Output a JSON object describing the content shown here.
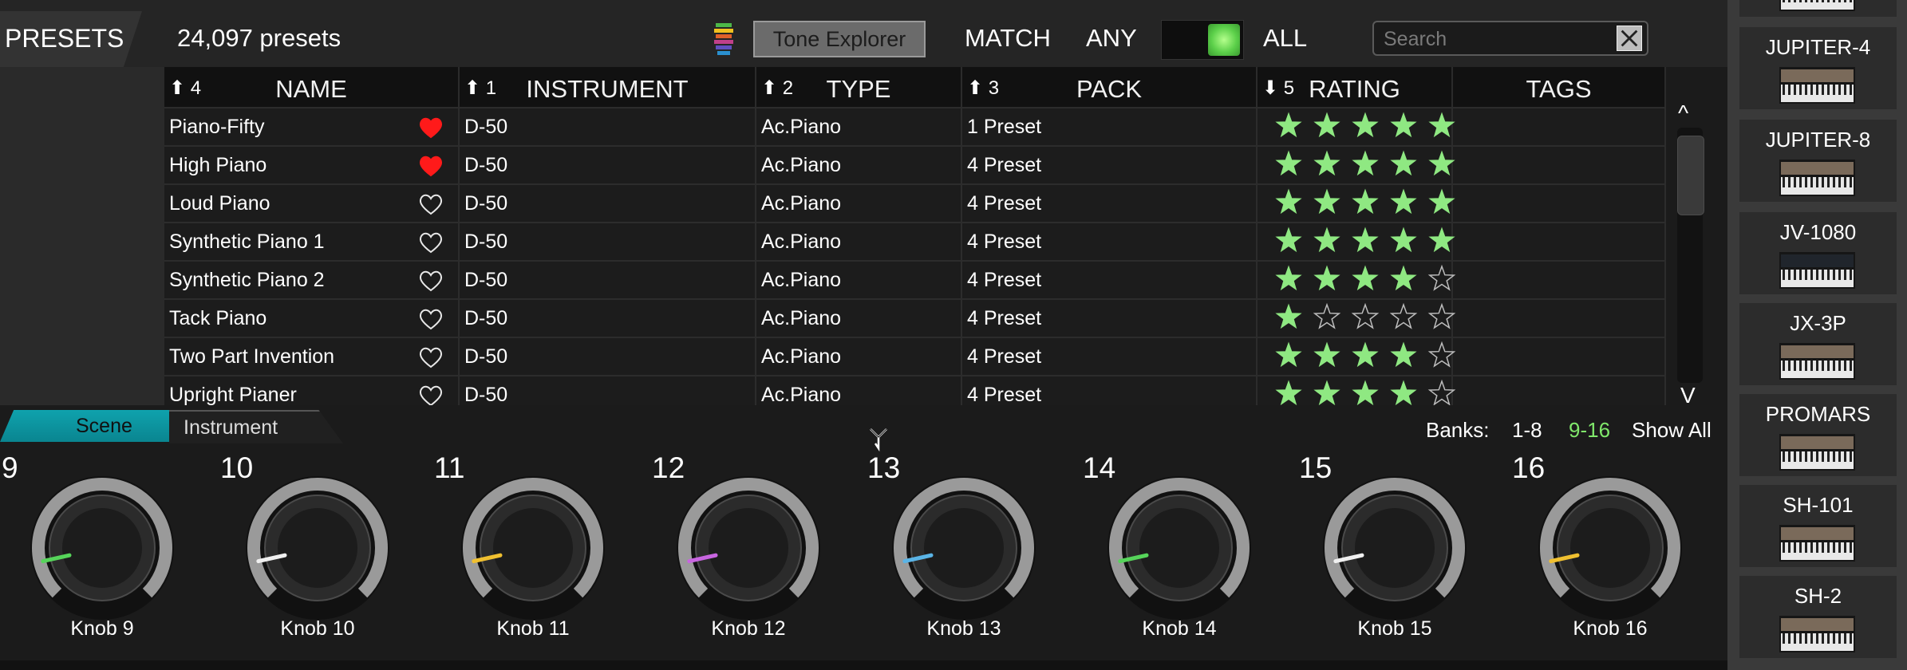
{
  "header": {
    "presets_label": "PRESETS",
    "preset_count": "24,097 presets",
    "tone_explorer_label": "Tone Explorer",
    "match_label": "MATCH",
    "any_label": "ANY",
    "all_label": "ALL",
    "match_all_enabled": true,
    "search_placeholder": "Search"
  },
  "table": {
    "columns": [
      {
        "order": "4",
        "label": "NAME",
        "sort": "asc"
      },
      {
        "order": "1",
        "label": "INSTRUMENT",
        "sort": "asc"
      },
      {
        "order": "2",
        "label": "TYPE",
        "sort": "asc"
      },
      {
        "order": "3",
        "label": "PACK",
        "sort": "asc"
      },
      {
        "order": "5",
        "label": "RATING",
        "sort": "desc"
      },
      {
        "order": "",
        "label": "TAGS",
        "sort": ""
      }
    ],
    "rows": [
      {
        "name": "Piano-Fifty",
        "favorite": true,
        "instrument": "D-50",
        "type": "Ac.Piano",
        "pack": "1 Preset",
        "rating": 5,
        "tags": ""
      },
      {
        "name": "High Piano",
        "favorite": true,
        "instrument": "D-50",
        "type": "Ac.Piano",
        "pack": "4 Preset",
        "rating": 5,
        "tags": ""
      },
      {
        "name": "Loud Piano",
        "favorite": false,
        "instrument": "D-50",
        "type": "Ac.Piano",
        "pack": "4 Preset",
        "rating": 5,
        "tags": ""
      },
      {
        "name": "Synthetic Piano 1",
        "favorite": false,
        "instrument": "D-50",
        "type": "Ac.Piano",
        "pack": "4 Preset",
        "rating": 5,
        "tags": ""
      },
      {
        "name": "Synthetic Piano 2",
        "favorite": false,
        "instrument": "D-50",
        "type": "Ac.Piano",
        "pack": "4 Preset",
        "rating": 4,
        "tags": ""
      },
      {
        "name": "Tack Piano",
        "favorite": false,
        "instrument": "D-50",
        "type": "Ac.Piano",
        "pack": "4 Preset",
        "rating": 1,
        "tags": ""
      },
      {
        "name": "Two Part Invention",
        "favorite": false,
        "instrument": "D-50",
        "type": "Ac.Piano",
        "pack": "4 Preset",
        "rating": 4,
        "tags": ""
      },
      {
        "name": "Upright Pianer",
        "favorite": false,
        "instrument": "D-50",
        "type": "Ac.Piano",
        "pack": "4 Preset",
        "rating": 4,
        "tags": ""
      }
    ],
    "scroll_up_label": "^",
    "scroll_down_label": "V"
  },
  "tabs": {
    "scene_label": "Scene",
    "instrument_label": "Instrument",
    "active": "Scene"
  },
  "banks": {
    "label": "Banks:",
    "bank_1_8": "1-8",
    "bank_9_16": "9-16",
    "show_all": "Show All",
    "active": "9-16"
  },
  "knobs": [
    {
      "number": "9",
      "label": "Knob 9",
      "color": "#56d45a",
      "value": 0.12
    },
    {
      "number": "10",
      "label": "Knob 10",
      "color": "#f0f0f0",
      "value": 0.12
    },
    {
      "number": "11",
      "label": "Knob 11",
      "color": "#f0c030",
      "value": 0.12
    },
    {
      "number": "12",
      "label": "Knob 12",
      "color": "#c865e0",
      "value": 0.12
    },
    {
      "number": "13",
      "label": "Knob 13",
      "color": "#5ab4e6",
      "value": 0.12
    },
    {
      "number": "14",
      "label": "Knob 14",
      "color": "#56d45a",
      "value": 0.12
    },
    {
      "number": "15",
      "label": "Knob 15",
      "color": "#f0f0f0",
      "value": 0.12
    },
    {
      "number": "16",
      "label": "Knob 16",
      "color": "#f0c030",
      "value": 0.12
    }
  ],
  "instruments": [
    {
      "name": "",
      "thumb": "synth-panel-icon"
    },
    {
      "name": "JUPITER-4",
      "thumb": "jupiter-4-synth-icon"
    },
    {
      "name": "JUPITER-8",
      "thumb": "jupiter-8-synth-icon"
    },
    {
      "name": "JV-1080",
      "thumb": "rack-module-icon"
    },
    {
      "name": "JX-3P",
      "thumb": "jx-3p-synth-icon"
    },
    {
      "name": "PROMARS",
      "thumb": "promars-synth-icon"
    },
    {
      "name": "SH-101",
      "thumb": "sh-101-synth-icon"
    },
    {
      "name": "SH-2",
      "thumb": "sh-2-synth-icon"
    }
  ],
  "colors": {
    "accent_green": "#80e86b",
    "star_green": "#8fe882",
    "heart_red": "#ff1a1a",
    "tab_teal": "#0fa2ad"
  }
}
